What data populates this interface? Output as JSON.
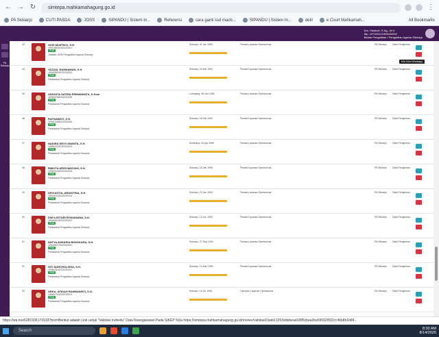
{
  "browser": {
    "url": "simtepa.mahkamahagung.go.id",
    "bookmarks": [
      {
        "label": "PA Sidoarjo"
      },
      {
        "label": "CUTI PASDA"
      },
      {
        "label": "JOSS"
      },
      {
        "label": "SIPANDU | Sistem In..."
      },
      {
        "label": "Referensi"
      },
      {
        "label": "cara ganti ssd macb..."
      },
      {
        "label": "SIPANDU | Sistem In..."
      },
      {
        "label": "detil"
      },
      {
        "label": "e Court Mahkamah..."
      }
    ],
    "all_bookmarks": "All Bookmarks"
  },
  "appbar": {
    "user_name": "Drs. Hasibah, S.Ag., M.H.",
    "user_sub1": "Nip. 197003121993032002",
    "user_sub2": "Badan Pengadilan / Pengadilan Agama Sidoarjo"
  },
  "sidebar": {
    "label": "PA Sidoarjo"
  },
  "tooltip": "Klik Kirim Whatsapp",
  "rows": [
    {
      "num": "43",
      "name": "ADIS MUSTIKO, S.H.",
      "nip": "199108252020121001",
      "badge": "PNS",
      "jab": "Jabatan: ASN Pengadilan Agama Sidoarjo",
      "tmt": "Sidoarjo, 01 Jan 1990",
      "pos": "Penata Layanan Operasional",
      "sat": "PA Sidoarjo",
      "sk": "Data Pengiriman"
    },
    {
      "num": "44",
      "name": "YAZZAL RAHMAWAN, S.H.",
      "nip": "199405202022031003",
      "badge": "PNS",
      "jab": "Pelaksana Pengadilan Agama Sidoarjo",
      "tmt": "Sidoarjo, 20 Mei 1994",
      "pos": "Penata Layanan Operasional",
      "sat": "PA Sidoarjo",
      "sk": "Data Pengiriman"
    },
    {
      "num": "45",
      "name": "ANGGITA SATRIA ERMAWANTA, S.Kom",
      "nip": "199501082022031005",
      "badge": "PNS",
      "jab": "Pelaksana Pengadilan Agama Sidoarjo",
      "tmt": "Lumajang, 08 Jan 1995",
      "pos": "Penata Layanan Operasional",
      "sat": "PA Sidoarjo",
      "sk": "Data Pengiriman"
    },
    {
      "num": "46",
      "name": "RATNAWATI, S.H.",
      "nip": "199010082022032006",
      "badge": "PNS",
      "jab": "Pelaksana Pengadilan Agama Sidoarjo",
      "tmt": "Sidoarjo, 08 Okt 1990",
      "pos": "Penata Layanan Operasional",
      "sat": "PA Sidoarjo",
      "sk": "Data Pengiriman"
    },
    {
      "num": "47",
      "name": "NADIRA DEVI LIMANTA, S.H.",
      "nip": "199504182022032003",
      "badge": "PNS",
      "jab": "Pelaksana Pengadilan Agama Sidoarjo",
      "tmt": "Surabaya, 18 Apr 1995",
      "pos": "Penata Layanan Operasional",
      "sat": "PA Sidoarjo",
      "sk": "Data Pengiriman"
    },
    {
      "num": "48",
      "name": "RIMOTA ARDIYANSYAH, S.H.",
      "nip": "199601252022031006",
      "badge": "PNS",
      "jab": "Pelaksana Pengadilan Agama Sidoarjo",
      "tmt": "Sidoarjo, 25 Jan 1996",
      "pos": "Penata Layanan Operasional",
      "sat": "PA Sidoarjo",
      "sk": "Data Pengiriman"
    },
    {
      "num": "49",
      "name": "DEVIASTIA, ARIANTINA, S.H.",
      "nip": "199401232022032003",
      "badge": "PNS",
      "jab": "Pelaksana Pengadilan Agama Sidoarjo",
      "tmt": "Sidoarjo, 23 Jan 1994",
      "pos": "Penata Layanan Operasional",
      "sat": "PA Sidoarjo",
      "sk": "Data Pengiriman"
    },
    {
      "num": "50",
      "name": "DWI LESTARI ROSIANANA, S.H.",
      "nip": "199406132022032002",
      "badge": "PNS",
      "jab": "Pelaksana Pengadilan Agama Sidoarjo",
      "tmt": "Sidoarjo, 13 Jun 1994",
      "pos": "Penata Layanan Operasional",
      "sat": "PA Sidoarjo",
      "sk": "Data Pengiriman"
    },
    {
      "num": "51",
      "name": "NATYA ANDARIA BHASKARA, S.H.",
      "nip": "199409272022032001",
      "badge": "PNS",
      "jab": "Pelaksana Pengadilan Agama Sidoarjo",
      "tmt": "Sidoarjo, 27 Sep 1994",
      "pos": "Penata Layanan Operasional",
      "sat": "PA Sidoarjo",
      "sk": "Data Pengiriman"
    },
    {
      "num": "52",
      "name": "SITI NURCHOLISHA, S.H.",
      "nip": "199503142022032002",
      "badge": "PNS",
      "jab": "Pelaksana Pengadilan Agama Sidoarjo",
      "tmt": "Sidoarjo, 14 Mar 1995",
      "pos": "Penata Layanan Operasional",
      "sat": "PA Sidoarjo",
      "sk": "Data Pengiriman"
    },
    {
      "num": "53",
      "name": "ARKA, AFIDAH RAHMANISTI, S.H.",
      "nip": "199607162022032003",
      "badge": "PNS",
      "jab": "Pelaksana Pengadilan Agama Sidoarjo",
      "tmt": "Sidoarjo, 16 Jul 1996",
      "pos": "Operator Layanan Operasional",
      "sat": "PA Sidoarjo",
      "sk": "Data Pengiriman"
    }
  ],
  "status_url": "https://wa.me/6281936171919?text=Berikut adalah Link untuk \"Validasi Individu\" Data Kepegawaian Pada SIKEP %0a https://simtepa.mahkamahagung.go.id/monev/validasi/2aab13253ddebead1885cbaa2ba59592/832cc46b8b1b84...",
  "taskbar": {
    "search_placeholder": "Search",
    "time": "8:30 AM",
    "date": "8/14/2026"
  }
}
